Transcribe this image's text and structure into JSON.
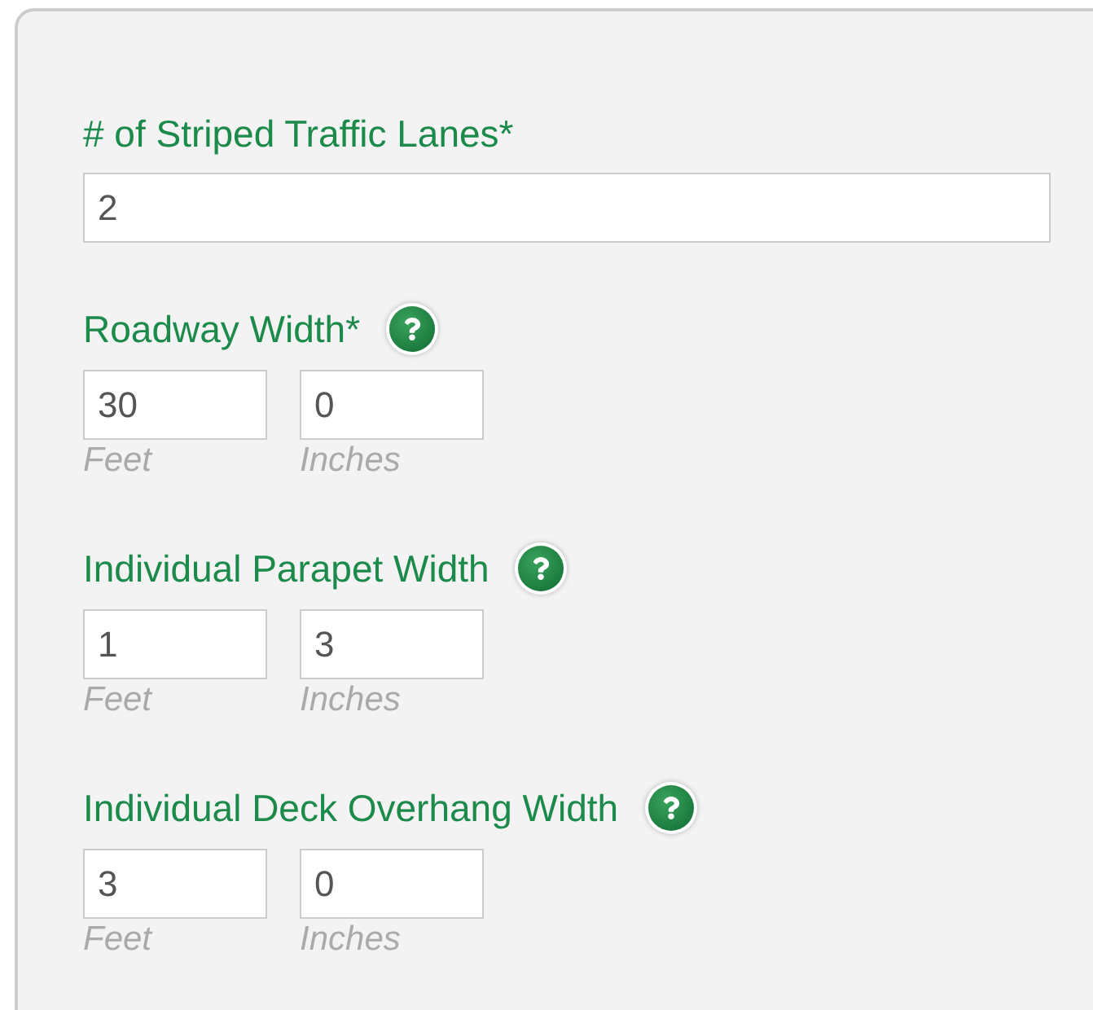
{
  "fields": [
    {
      "kind": "single",
      "label": "# of Striped Traffic Lanes*",
      "help": false,
      "value": "2"
    },
    {
      "kind": "dimension",
      "label": "Roadway Width*",
      "help": true,
      "feet": {
        "value": "30",
        "unit": "Feet"
      },
      "inches": {
        "value": "0",
        "unit": "Inches"
      }
    },
    {
      "kind": "dimension",
      "label": "Individual Parapet Width",
      "help": true,
      "feet": {
        "value": "1",
        "unit": "Feet"
      },
      "inches": {
        "value": "3",
        "unit": "Inches"
      }
    },
    {
      "kind": "dimension",
      "label": "Individual Deck Overhang Width",
      "help": true,
      "feet": {
        "value": "3",
        "unit": "Feet"
      },
      "inches": {
        "value": "0",
        "unit": "Inches"
      }
    }
  ]
}
